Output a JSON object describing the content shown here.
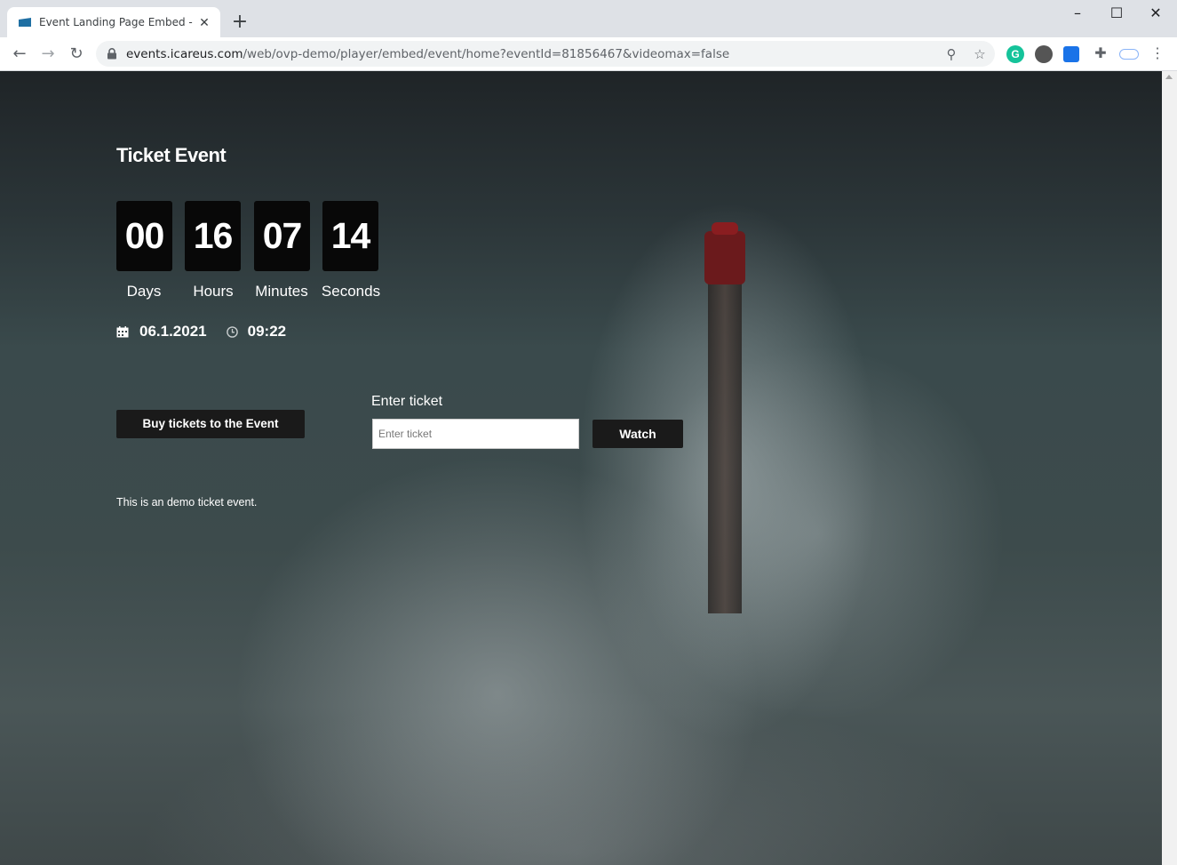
{
  "browser": {
    "tab_title": "Event Landing Page Embed - OVP",
    "url_host": "events.icareus.com",
    "url_path": "/web/ovp-demo/player/embed/event/home?eventId=81856467&videomax=false",
    "new_tab_icon": "plus-icon",
    "accent_color": "#1a73e8"
  },
  "event": {
    "title": "Ticket Event",
    "countdown": [
      {
        "value": "00",
        "label": "Days"
      },
      {
        "value": "16",
        "label": "Hours"
      },
      {
        "value": "07",
        "label": "Minutes"
      },
      {
        "value": "14",
        "label": "Seconds"
      }
    ],
    "date": "06.1.2021",
    "time": "09:22",
    "buy_button": "Buy tickets to the Event",
    "ticket_label": "Enter ticket",
    "ticket_placeholder": "Enter ticket",
    "watch_button": "Watch",
    "description": "This is an demo ticket event."
  }
}
